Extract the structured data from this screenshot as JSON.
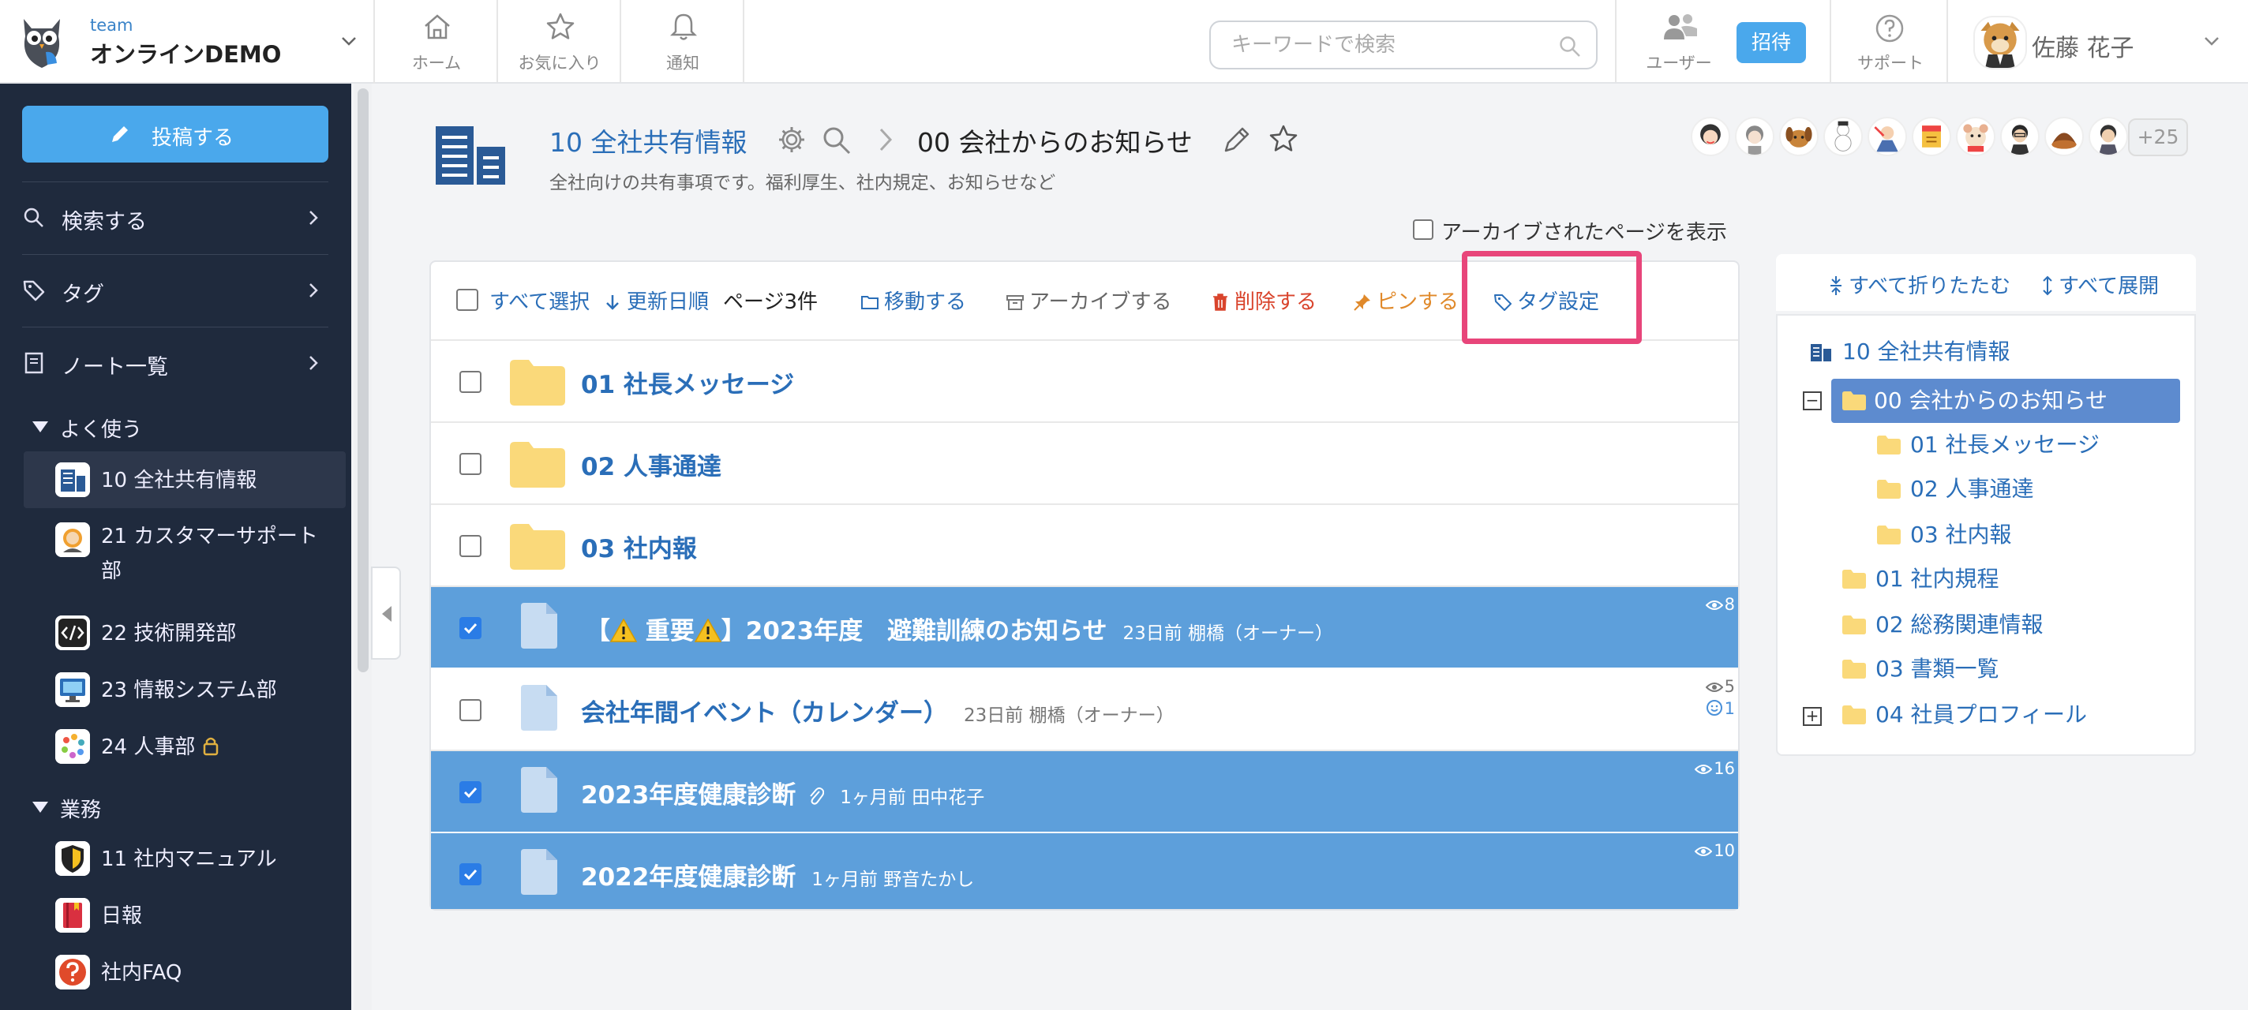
{
  "brand": {
    "team": "team",
    "name": "オンラインDEMO"
  },
  "nav": {
    "home": "ホーム",
    "favorites": "お気に入り",
    "notifications": "通知"
  },
  "search": {
    "placeholder": "キーワードで検索"
  },
  "header_right": {
    "users": "ユーザー",
    "invite": "招待",
    "support": "サポート",
    "user_name": "佐藤 花子"
  },
  "sidebar": {
    "post_button": "投稿する",
    "rows": [
      {
        "label": "検索する",
        "icon": "search-icon"
      },
      {
        "label": "タグ",
        "icon": "tag-icon"
      },
      {
        "label": "ノート一覧",
        "icon": "notebook-icon"
      }
    ],
    "sections": [
      {
        "title": "よく使う",
        "items": [
          {
            "label": "10 全社共有情報",
            "active": true
          },
          {
            "label": "21 カスタマーサポート部"
          },
          {
            "label": "22 技術開発部"
          },
          {
            "label": "23 情報システム部"
          },
          {
            "label": "24 人事部"
          }
        ]
      },
      {
        "title": "業務",
        "items": [
          {
            "label": "11 社内マニュアル"
          },
          {
            "label": "日報"
          },
          {
            "label": "社内FAQ"
          }
        ]
      }
    ]
  },
  "page": {
    "breadcrumb_parent": "10 全社共有情報",
    "breadcrumb_current": "00 会社からのお知らせ",
    "description": "全社向けの共有事項です。福利厚生、社内規定、お知らせなど",
    "members_more": "+25",
    "show_archived": "アーカイブされたページを表示"
  },
  "toolbar": {
    "select_all": "すべて選択",
    "sort": "更新日順",
    "count": "ページ3件",
    "move": "移動する",
    "archive": "アーカイブする",
    "delete": "削除する",
    "pin": "ピンする",
    "tag_settings": "タグ設定"
  },
  "folders": [
    {
      "title": "01 社長メッセージ"
    },
    {
      "title": "02 人事通達"
    },
    {
      "title": "03 社内報"
    }
  ],
  "pages": [
    {
      "title_pre": "【",
      "title_mid": " 重要",
      "title_post": "】2023年度　避難訓練のお知らせ",
      "meta": "23日前  棚橋（オーナー）",
      "views": "8",
      "selected": true
    },
    {
      "title": "会社年間イベント（カレンダー）",
      "meta": "23日前  棚橋（オーナー）",
      "views": "5",
      "reactions": "1",
      "selected": false
    },
    {
      "title": "2023年度健康診断",
      "meta": "1ヶ月前  田中花子",
      "views": "16",
      "selected": true,
      "attachment": true
    },
    {
      "title": "2022年度健康診断",
      "meta": "1ヶ月前  野音たかし",
      "views": "10",
      "selected": true
    }
  ],
  "tree": {
    "collapse_all": "すべて折りたたむ",
    "expand_all": "すべて展開",
    "items": [
      {
        "label": "10 全社共有情報"
      },
      {
        "label": "00 会社からのお知らせ",
        "active": true
      },
      {
        "label": "01 社長メッセージ"
      },
      {
        "label": "02 人事通達"
      },
      {
        "label": "03 社内報"
      },
      {
        "label": "01 社内規程"
      },
      {
        "label": "02 総務関連情報"
      },
      {
        "label": "03 書類一覧"
      },
      {
        "label": "04 社員プロフィール"
      }
    ]
  },
  "colors": {
    "accent": "#4aa8ec",
    "sidebar_bg": "#1f2a3d",
    "selected_row": "#5d9fdb",
    "highlight": "#e8457a",
    "delete": "#d9442c",
    "pin": "#e0892a"
  }
}
